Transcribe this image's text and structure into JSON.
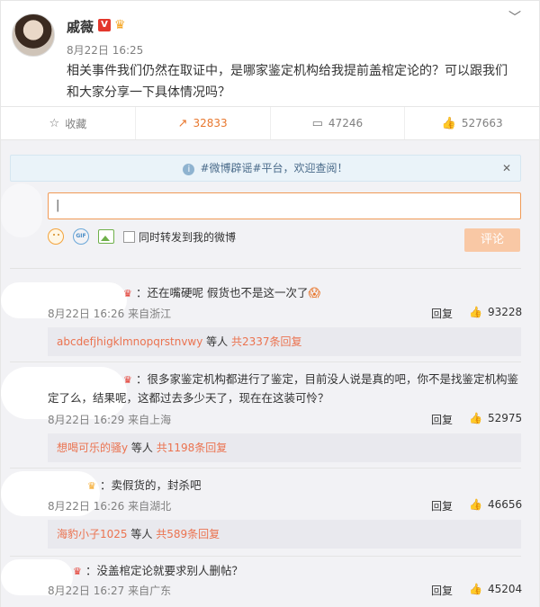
{
  "post": {
    "author": "戚薇",
    "vbadge": "V",
    "time": "8月22日 16:25",
    "text": "相关事件我们仍然在取证中，是哪家鉴定机构给我提前盖棺定论的？可以跟我们和大家分享一下具体情况吗？"
  },
  "actions": {
    "favorite": "收藏",
    "forward": "32833",
    "comment": "47246",
    "like": "527663"
  },
  "commentbox": {
    "tip": "#微博辟谣#平台，欢迎查阅！",
    "input_value": "|",
    "share_label": "同时转发到我的微博",
    "submit": "评论",
    "gif": "GIF"
  },
  "comments": [
    {
      "text": "：还在嘴硬呢 假货也不是这一次了",
      "emoji": "😱",
      "meta": "8月22日 16:26 来自浙江",
      "reply": "回复",
      "likes": "93228",
      "sub_user": "abcdefjhigklmnopqrstnvwy",
      "sub_mid": " 等人 ",
      "sub_count": "共2337条回复"
    },
    {
      "text": "：很多家鉴定机构都进行了鉴定，目前没人说是真的吧，你不是找鉴定机构鉴定了么，结果呢，这都过去多少天了，现在在这装可怜？",
      "meta": "8月22日 16:29 来自上海",
      "reply": "回复",
      "likes": "52975",
      "sub_user": "想喝可乐的骚y",
      "sub_mid": " 等人 ",
      "sub_count": "共1198条回复"
    },
    {
      "text": "：卖假货的，封杀吧",
      "meta": "8月22日 16:26 来自湖北",
      "reply": "回复",
      "likes": "46656",
      "sub_user": "海豹小子1025",
      "sub_mid": " 等人 ",
      "sub_count": "共589条回复"
    },
    {
      "text": "：没盖棺定论就要求别人删帖？",
      "meta": "8月22日 16:27 来自广东",
      "reply": "回复",
      "likes": "45204"
    }
  ]
}
